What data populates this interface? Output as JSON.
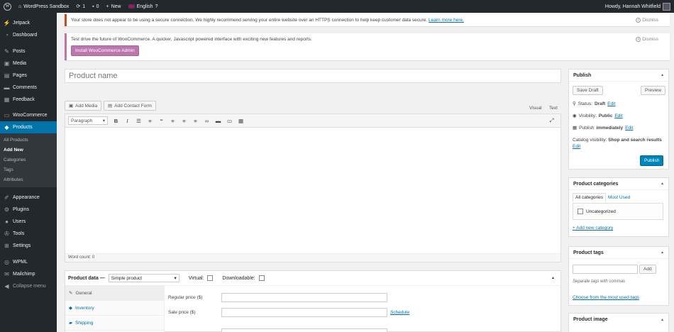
{
  "admin_bar": {
    "site_name": "WordPress Sandbox",
    "updates_count": "1",
    "comments_count": "0",
    "new_label": "New",
    "language": "English",
    "greeting": "Howdy, Hannah Whitfield"
  },
  "sidebar": {
    "items": [
      {
        "label": "Jetpack",
        "icon": "jetpack-icon",
        "glyph": "⚡"
      },
      {
        "label": "Dashboard",
        "icon": "dashboard-icon",
        "glyph": "◔"
      },
      {
        "label": "Posts",
        "icon": "pin-icon",
        "glyph": "✎"
      },
      {
        "label": "Media",
        "icon": "media-icon",
        "glyph": "▣"
      },
      {
        "label": "Pages",
        "icon": "pages-icon",
        "glyph": "▤"
      },
      {
        "label": "Comments",
        "icon": "comments-icon",
        "glyph": "▬"
      },
      {
        "label": "Feedback",
        "icon": "feedback-icon",
        "glyph": "▦"
      },
      {
        "label": "WooCommerce",
        "icon": "woocommerce-icon",
        "glyph": "▭"
      },
      {
        "label": "Products",
        "icon": "products-icon",
        "glyph": "◆"
      }
    ],
    "submenu": [
      "All Products",
      "Add New",
      "Categories",
      "Tags",
      "Attributes"
    ],
    "items2": [
      {
        "label": "Appearance",
        "icon": "appearance-icon",
        "glyph": "✐"
      },
      {
        "label": "Plugins",
        "icon": "plugins-icon",
        "glyph": "⚙"
      },
      {
        "label": "Users",
        "icon": "users-icon",
        "glyph": "●"
      },
      {
        "label": "Tools",
        "icon": "tools-icon",
        "glyph": "✇"
      },
      {
        "label": "Settings",
        "icon": "settings-icon",
        "glyph": "⊞"
      }
    ],
    "items3": [
      {
        "label": "WPML",
        "icon": "wpml-icon",
        "glyph": "◎"
      },
      {
        "label": "Mailchimp",
        "icon": "mailchimp-icon",
        "glyph": "✉"
      }
    ],
    "collapse": "Collapse menu"
  },
  "notices": {
    "https_text": "Your store does not appear to be using a secure connection. We highly recommend serving your entire website over an HTTPS connection to help keep customer data secure.",
    "learn_more": "Learn more here.",
    "dismiss": "Dismiss",
    "woo_text": "Test drive the future of WooCommerce. A quicker, Javascript powered interface with exciting new features and reports.",
    "install_btn": "Install WooCommerce Admin"
  },
  "editor": {
    "title_placeholder": "Product name",
    "add_media": "Add Media",
    "add_contact_form": "Add Contact Form",
    "tab_visual": "Visual",
    "tab_text": "Text",
    "format_select": "Paragraph",
    "word_count": "Word count: 0"
  },
  "product_data": {
    "label": "Product data —",
    "type": "Simple product",
    "virtual": "Virtual:",
    "downloadable": "Downloadable:",
    "tabs": [
      "General",
      "Inventory",
      "Shipping"
    ],
    "regular_price": "Regular price ($)",
    "sale_price": "Sale price ($)",
    "schedule": "Schedule"
  },
  "publish": {
    "title": "Publish",
    "save_draft": "Save Draft",
    "preview": "Preview",
    "status_label": "Status:",
    "status_value": "Draft",
    "visibility_label": "Visibility:",
    "visibility_value": "Public",
    "publish_label": "Publish",
    "publish_value": "immediately",
    "edit": "Edit",
    "catalog_label": "Catalog visibility:",
    "catalog_value": "Shop and search results",
    "publish_btn": "Publish"
  },
  "categories": {
    "title": "Product categories",
    "tab_all": "All categories",
    "tab_most": "Most Used",
    "item": "Uncategorized",
    "add_new": "+ Add new category"
  },
  "tags": {
    "title": "Product tags",
    "add_btn": "Add",
    "hint": "Separate tags with commas",
    "choose": "Choose from the most used tags"
  },
  "image": {
    "title": "Product image"
  }
}
